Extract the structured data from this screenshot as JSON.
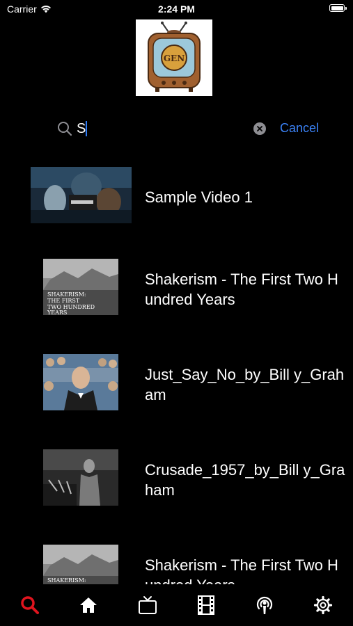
{
  "status_bar": {
    "carrier": "Carrier",
    "time": "2:24 PM"
  },
  "search": {
    "value": "S",
    "cancel_label": "Cancel"
  },
  "results": [
    {
      "title": "Sample Video 1",
      "thumb": "dark-fantasy-scene"
    },
    {
      "title": "Shakerism - The First Two Hundred Years",
      "thumb": "shakerism-title-card"
    },
    {
      "title": "Just_Say_No_by_Bill y_Graham",
      "thumb": "preacher-crowd"
    },
    {
      "title": "Crusade_1957_by_Bill y_Graham",
      "thumb": "preacher-podium"
    },
    {
      "title": "Shakerism - The First Two Hundred Years",
      "thumb": "shakerism-title-card"
    }
  ],
  "tab_bar": {
    "items": [
      {
        "icon": "search-icon",
        "active": true
      },
      {
        "icon": "home-icon",
        "active": false
      },
      {
        "icon": "tv-icon",
        "active": false
      },
      {
        "icon": "film-icon",
        "active": false
      },
      {
        "icon": "podcast-icon",
        "active": false
      },
      {
        "icon": "gear-icon",
        "active": false
      }
    ]
  },
  "colors": {
    "background": "#000000",
    "accent_blue": "#3b82f6",
    "active_tab": "#e0141e",
    "inactive_tab": "#ffffff"
  }
}
